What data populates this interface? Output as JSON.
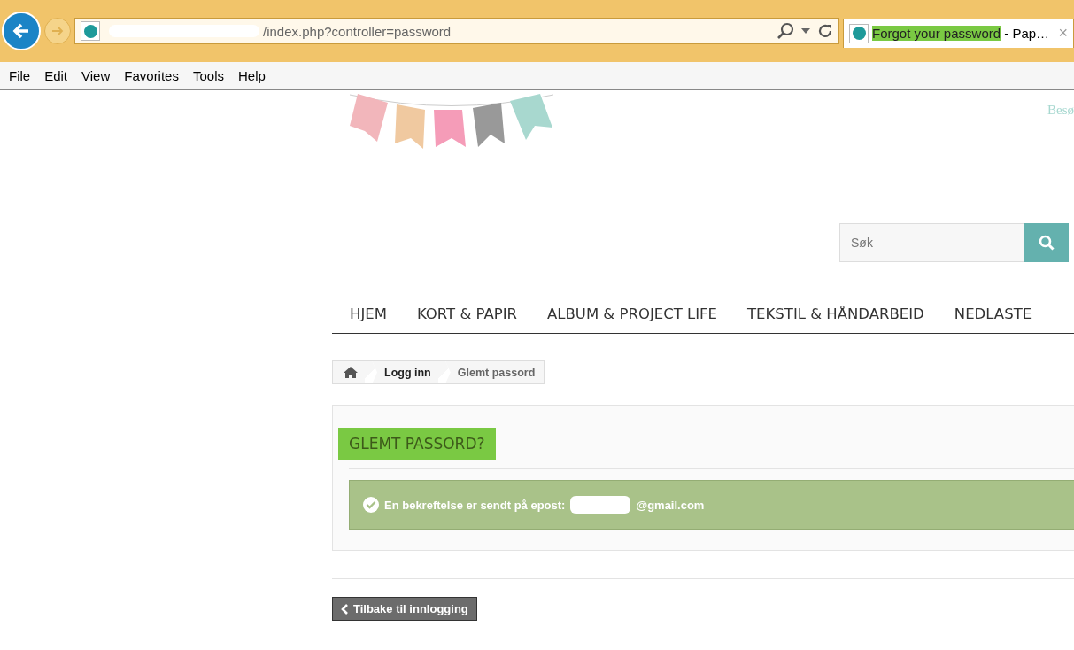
{
  "browser": {
    "address": "/index.php?controller=password",
    "tab": {
      "title_highlighted": "Forgot your password",
      "title_rest": " - Pap…",
      "selected": true
    },
    "close_tab": "×"
  },
  "menu": [
    "File",
    "Edit",
    "View",
    "Favorites",
    "Tools",
    "Help"
  ],
  "header": {
    "top_link": "Besø",
    "search": {
      "placeholder": "Søk"
    }
  },
  "nav": [
    "HJEM",
    "KORT & PAPIR",
    "ALBUM & PROJECT LIFE",
    "TEKSTIL & HÅNDARBEID",
    "NEDLASTE"
  ],
  "breadcrumb": [
    {
      "label": "Logg inn",
      "current": false
    },
    {
      "label": "Glemt passord",
      "current": true
    }
  ],
  "panel": {
    "heading": "GLEMT PASSORD?",
    "alert": {
      "kind": "success",
      "text": "En bekreftelse er sendt på epost:",
      "email": "@gmail.com"
    }
  },
  "back_button": "Tilbake til innlogging"
}
